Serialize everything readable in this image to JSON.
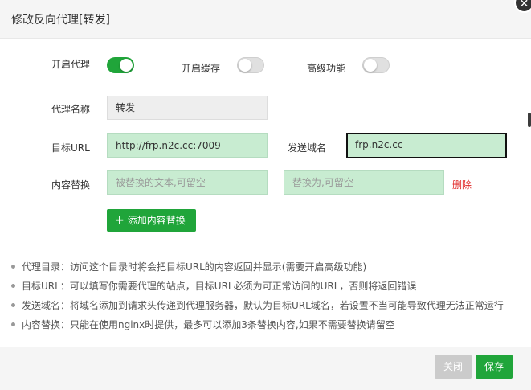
{
  "dialog": {
    "title": "修改反向代理[转发]"
  },
  "toggles": [
    {
      "label": "开启代理",
      "on": true
    },
    {
      "label": "开启缓存",
      "on": false
    },
    {
      "label": "高级功能",
      "on": false
    }
  ],
  "form": {
    "proxy_name": {
      "label": "代理名称",
      "value": "转发"
    },
    "target_url": {
      "label": "目标URL",
      "value": "http://frp.n2c.cc:7009"
    },
    "send_domain": {
      "label": "发送域名",
      "value": "frp.n2c.cc"
    },
    "content_replace": {
      "label": "内容替换",
      "find_placeholder": "被替换的文本,可留空",
      "replace_placeholder": "替换为,可留空",
      "delete_label": "删除",
      "add_label": "添加内容替换"
    }
  },
  "notes": [
    "代理目录：访问这个目录时将会把目标URL的内容返回并显示(需要开启高级功能)",
    "目标URL：可以填写你需要代理的站点，目标URL必须为可正常访问的URL，否则将返回错误",
    "发送域名：将域名添加到请求头传递到代理服务器，默认为目标URL域名，若设置不当可能导致代理无法正常运行",
    "内容替换：只能在使用nginx时提供，最多可以添加3条替换内容,如果不需要替换请留空"
  ],
  "footer": {
    "close_label": "关闭",
    "save_label": "保存"
  },
  "colors": {
    "accent": "#20a53a",
    "danger": "#e02020",
    "input_bg": "#c8ecd1"
  }
}
